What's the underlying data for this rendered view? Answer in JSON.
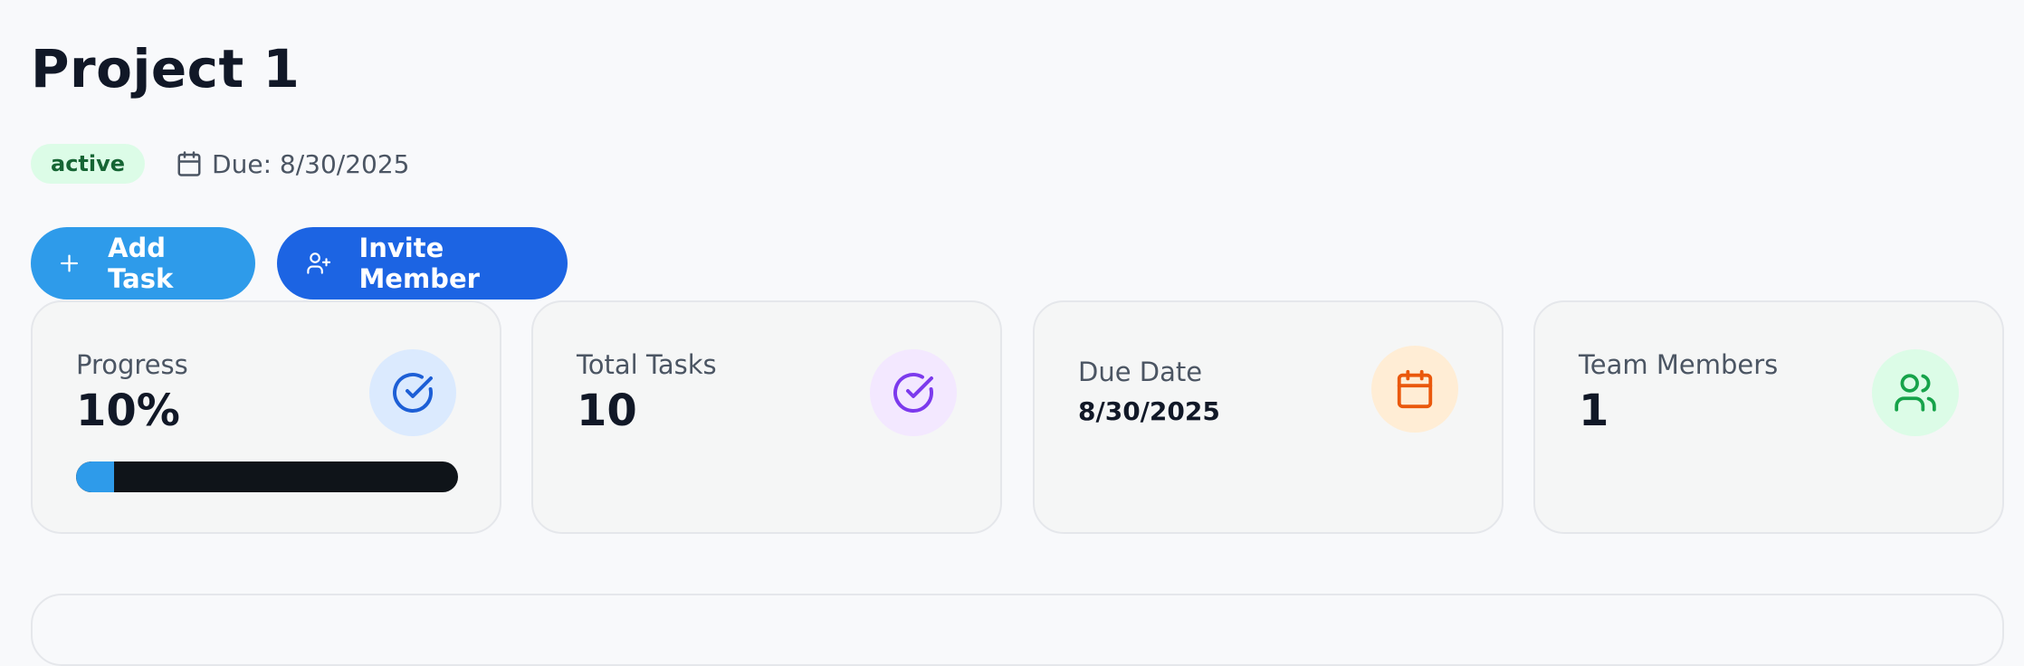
{
  "project": {
    "title": "Project 1",
    "status": "active",
    "due_label": "Due: 8/30/2025"
  },
  "actions": {
    "add_task": "Add Task",
    "invite_member": "Invite Member"
  },
  "stats": {
    "progress": {
      "label": "Progress",
      "value": "10%",
      "fraction": 0.1,
      "icon": "check-circle-icon"
    },
    "total_tasks": {
      "label": "Total Tasks",
      "value": "10",
      "icon": "check-circle-icon"
    },
    "due_date": {
      "label": "Due Date",
      "value": "8/30/2025",
      "icon": "calendar-icon"
    },
    "team_members": {
      "label": "Team Members",
      "value": "1",
      "icon": "users-icon"
    }
  },
  "colors": {
    "status_active_bg": "#dcfce7",
    "add_task_button": "#2e9bea",
    "invite_button": "#1c64e3",
    "progress_icon": "#1d5fd6",
    "tasks_icon": "#7c3aed",
    "due_icon": "#ea580c",
    "members_icon": "#16a34a"
  }
}
